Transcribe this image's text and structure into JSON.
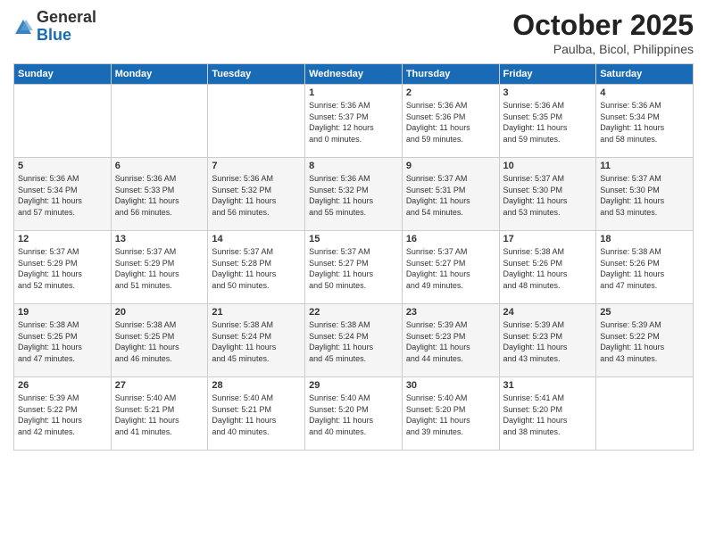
{
  "header": {
    "logo": {
      "general": "General",
      "blue": "Blue"
    },
    "title": "October 2025",
    "location": "Paulba, Bicol, Philippines"
  },
  "calendar": {
    "days_of_week": [
      "Sunday",
      "Monday",
      "Tuesday",
      "Wednesday",
      "Thursday",
      "Friday",
      "Saturday"
    ],
    "weeks": [
      [
        {
          "day": "",
          "info": ""
        },
        {
          "day": "",
          "info": ""
        },
        {
          "day": "",
          "info": ""
        },
        {
          "day": "1",
          "info": "Sunrise: 5:36 AM\nSunset: 5:37 PM\nDaylight: 12 hours\nand 0 minutes."
        },
        {
          "day": "2",
          "info": "Sunrise: 5:36 AM\nSunset: 5:36 PM\nDaylight: 11 hours\nand 59 minutes."
        },
        {
          "day": "3",
          "info": "Sunrise: 5:36 AM\nSunset: 5:35 PM\nDaylight: 11 hours\nand 59 minutes."
        },
        {
          "day": "4",
          "info": "Sunrise: 5:36 AM\nSunset: 5:34 PM\nDaylight: 11 hours\nand 58 minutes."
        }
      ],
      [
        {
          "day": "5",
          "info": "Sunrise: 5:36 AM\nSunset: 5:34 PM\nDaylight: 11 hours\nand 57 minutes."
        },
        {
          "day": "6",
          "info": "Sunrise: 5:36 AM\nSunset: 5:33 PM\nDaylight: 11 hours\nand 56 minutes."
        },
        {
          "day": "7",
          "info": "Sunrise: 5:36 AM\nSunset: 5:32 PM\nDaylight: 11 hours\nand 56 minutes."
        },
        {
          "day": "8",
          "info": "Sunrise: 5:36 AM\nSunset: 5:32 PM\nDaylight: 11 hours\nand 55 minutes."
        },
        {
          "day": "9",
          "info": "Sunrise: 5:37 AM\nSunset: 5:31 PM\nDaylight: 11 hours\nand 54 minutes."
        },
        {
          "day": "10",
          "info": "Sunrise: 5:37 AM\nSunset: 5:30 PM\nDaylight: 11 hours\nand 53 minutes."
        },
        {
          "day": "11",
          "info": "Sunrise: 5:37 AM\nSunset: 5:30 PM\nDaylight: 11 hours\nand 53 minutes."
        }
      ],
      [
        {
          "day": "12",
          "info": "Sunrise: 5:37 AM\nSunset: 5:29 PM\nDaylight: 11 hours\nand 52 minutes."
        },
        {
          "day": "13",
          "info": "Sunrise: 5:37 AM\nSunset: 5:29 PM\nDaylight: 11 hours\nand 51 minutes."
        },
        {
          "day": "14",
          "info": "Sunrise: 5:37 AM\nSunset: 5:28 PM\nDaylight: 11 hours\nand 50 minutes."
        },
        {
          "day": "15",
          "info": "Sunrise: 5:37 AM\nSunset: 5:27 PM\nDaylight: 11 hours\nand 50 minutes."
        },
        {
          "day": "16",
          "info": "Sunrise: 5:37 AM\nSunset: 5:27 PM\nDaylight: 11 hours\nand 49 minutes."
        },
        {
          "day": "17",
          "info": "Sunrise: 5:38 AM\nSunset: 5:26 PM\nDaylight: 11 hours\nand 48 minutes."
        },
        {
          "day": "18",
          "info": "Sunrise: 5:38 AM\nSunset: 5:26 PM\nDaylight: 11 hours\nand 47 minutes."
        }
      ],
      [
        {
          "day": "19",
          "info": "Sunrise: 5:38 AM\nSunset: 5:25 PM\nDaylight: 11 hours\nand 47 minutes."
        },
        {
          "day": "20",
          "info": "Sunrise: 5:38 AM\nSunset: 5:25 PM\nDaylight: 11 hours\nand 46 minutes."
        },
        {
          "day": "21",
          "info": "Sunrise: 5:38 AM\nSunset: 5:24 PM\nDaylight: 11 hours\nand 45 minutes."
        },
        {
          "day": "22",
          "info": "Sunrise: 5:38 AM\nSunset: 5:24 PM\nDaylight: 11 hours\nand 45 minutes."
        },
        {
          "day": "23",
          "info": "Sunrise: 5:39 AM\nSunset: 5:23 PM\nDaylight: 11 hours\nand 44 minutes."
        },
        {
          "day": "24",
          "info": "Sunrise: 5:39 AM\nSunset: 5:23 PM\nDaylight: 11 hours\nand 43 minutes."
        },
        {
          "day": "25",
          "info": "Sunrise: 5:39 AM\nSunset: 5:22 PM\nDaylight: 11 hours\nand 43 minutes."
        }
      ],
      [
        {
          "day": "26",
          "info": "Sunrise: 5:39 AM\nSunset: 5:22 PM\nDaylight: 11 hours\nand 42 minutes."
        },
        {
          "day": "27",
          "info": "Sunrise: 5:40 AM\nSunset: 5:21 PM\nDaylight: 11 hours\nand 41 minutes."
        },
        {
          "day": "28",
          "info": "Sunrise: 5:40 AM\nSunset: 5:21 PM\nDaylight: 11 hours\nand 40 minutes."
        },
        {
          "day": "29",
          "info": "Sunrise: 5:40 AM\nSunset: 5:20 PM\nDaylight: 11 hours\nand 40 minutes."
        },
        {
          "day": "30",
          "info": "Sunrise: 5:40 AM\nSunset: 5:20 PM\nDaylight: 11 hours\nand 39 minutes."
        },
        {
          "day": "31",
          "info": "Sunrise: 5:41 AM\nSunset: 5:20 PM\nDaylight: 11 hours\nand 38 minutes."
        },
        {
          "day": "",
          "info": ""
        }
      ]
    ]
  }
}
